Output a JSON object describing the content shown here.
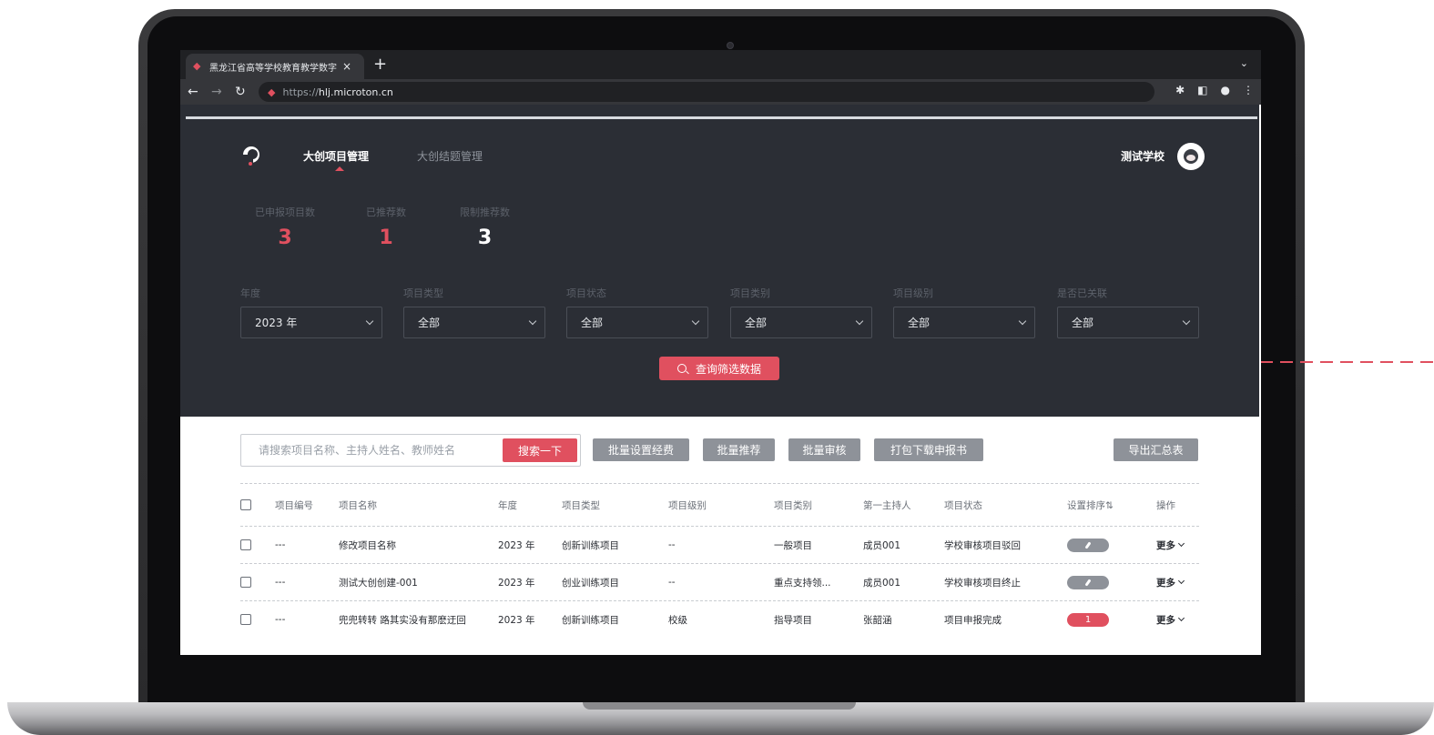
{
  "browser": {
    "tab_title": "黑龙江省高等学校教育教学数字",
    "tab_close": "×",
    "new_tab": "+",
    "url_scheme": "https://",
    "url_host": "hlj.microton.cn"
  },
  "nav": {
    "items": [
      {
        "label": "大创项目管理",
        "active": true
      },
      {
        "label": "大创结题管理",
        "active": false
      }
    ],
    "school": "测试学校"
  },
  "stats": [
    {
      "label": "已申报项目数",
      "value": "3",
      "color": "#e0505f"
    },
    {
      "label": "已推荐数",
      "value": "1",
      "color": "#e0505f"
    },
    {
      "label": "限制推荐数",
      "value": "3",
      "color": "#ffffff"
    }
  ],
  "filters": [
    {
      "label": "年度",
      "value": "2023 年"
    },
    {
      "label": "项目类型",
      "value": "全部"
    },
    {
      "label": "项目状态",
      "value": "全部"
    },
    {
      "label": "项目类别",
      "value": "全部"
    },
    {
      "label": "项目级别",
      "value": "全部"
    },
    {
      "label": "是否已关联",
      "value": "全部"
    }
  ],
  "query_button": "查询筛选数据",
  "search": {
    "placeholder": "请搜索项目名称、主持人姓名、教师姓名",
    "button": "搜索一下"
  },
  "actions": {
    "batch_fee": "批量设置经费",
    "batch_recommend": "批量推荐",
    "batch_review": "批量审核",
    "download": "打包下载申报书",
    "export": "导出汇总表"
  },
  "table": {
    "headers": [
      "项目编号",
      "项目名称",
      "年度",
      "项目类型",
      "项目级别",
      "项目类别",
      "第一主持人",
      "项目状态",
      "设置排序⇅",
      "操作"
    ],
    "rows": [
      {
        "id": "---",
        "name": "修改项目名称",
        "year": "2023 年",
        "type": "创新训练项目",
        "level": "--",
        "category": "一般项目",
        "host": "成员001",
        "status": "学校审核项目驳回",
        "sort": "",
        "action": "更多"
      },
      {
        "id": "---",
        "name": "测试大创创建-001",
        "year": "2023 年",
        "type": "创业训练项目",
        "level": "--",
        "category": "重点支持领...",
        "host": "成员001",
        "status": "学校审核项目终止",
        "sort": "",
        "action": "更多"
      },
      {
        "id": "---",
        "name": "兜兜转转 路其实没有那麽迂回",
        "year": "2023 年",
        "type": "创新训练项目",
        "level": "校级",
        "category": "指导项目",
        "host": "张韶涵",
        "status": "项目申报完成",
        "sort": "1",
        "action": "更多"
      }
    ]
  },
  "colors": {
    "accent": "#e0505f",
    "dark_bg": "#2b2e35",
    "gray_button": "#8e9299"
  }
}
